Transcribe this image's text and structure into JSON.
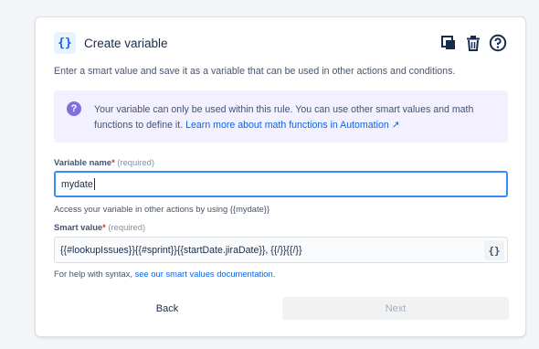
{
  "dialog": {
    "icon_glyph": "{}",
    "title": "Create variable",
    "actions": [
      "duplicate-icon",
      "trash-icon",
      "help-icon"
    ],
    "description": "Enter a smart value and save it as a variable that can be used in other actions and conditions.",
    "info": {
      "icon_glyph": "?",
      "text": "Your variable can only be used within this rule. You can use other smart values and math functions to define it.",
      "link": "Learn more about math functions in Automation ↗"
    },
    "variable_name": {
      "label": "Variable name",
      "required_mark": "*",
      "required_text": "(required)",
      "value": "mydate",
      "helper": "Access your variable in other actions by using {{mydate}}"
    },
    "smart_value": {
      "label": "Smart value",
      "required_mark": "*",
      "required_text": "(required)",
      "value": "{{#lookupIssues}}{{#sprint}}{{startDate.jiraDate}}, {{/}}{{/}}",
      "button_glyph": "{}",
      "helper_prefix": "For help with syntax, ",
      "helper_link": "see our smart values documentation",
      "helper_suffix": "."
    },
    "buttons": {
      "back": "Back",
      "next": "Next"
    }
  },
  "colors": {
    "accent": "#0c66e4",
    "focus_border": "#388bff",
    "info_bg": "#f3f0ff",
    "info_icon": "#8270db",
    "required": "#c9372c"
  }
}
